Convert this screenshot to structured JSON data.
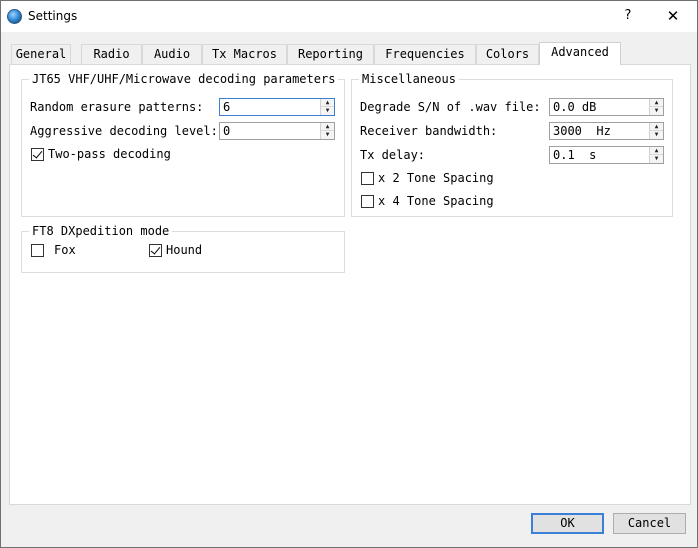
{
  "window": {
    "title": "Settings",
    "help_label": "?",
    "close_label": "✕"
  },
  "tabs": [
    {
      "label": "General",
      "active": false
    },
    {
      "label": "Radio",
      "active": false
    },
    {
      "label": "Audio",
      "active": false
    },
    {
      "label": "Tx Macros",
      "active": false
    },
    {
      "label": "Reporting",
      "active": false
    },
    {
      "label": "Frequencies",
      "active": false
    },
    {
      "label": "Colors",
      "active": false
    },
    {
      "label": "Advanced",
      "active": true
    }
  ],
  "jt65": {
    "title": "JT65 VHF/UHF/Microwave decoding parameters",
    "random_erasure": {
      "label": "Random erasure patterns:",
      "value": "6"
    },
    "aggressive": {
      "label": "Aggressive decoding level:",
      "value": "0"
    },
    "two_pass": {
      "label": "Two-pass decoding",
      "checked": true
    }
  },
  "misc": {
    "title": "Miscellaneous",
    "degrade": {
      "label": "Degrade S/N of .wav file:",
      "value": "0.0 dB"
    },
    "bandwidth": {
      "label": "Receiver bandwidth:",
      "value": "3000  Hz"
    },
    "tx_delay": {
      "label": "Tx delay:",
      "value": "0.1  s"
    },
    "x2": {
      "label": "x 2 Tone Spacing",
      "checked": false
    },
    "x4": {
      "label": "x 4 Tone Spacing",
      "checked": false
    }
  },
  "ft8": {
    "title": "FT8 DXpedition mode",
    "fox": {
      "label": "Fox",
      "checked": false
    },
    "hound": {
      "label": "Hound",
      "checked": true
    }
  },
  "buttons": {
    "ok": "OK",
    "cancel": "Cancel"
  },
  "colors": {
    "focus_border": "#3a7fd1",
    "default_button_border": "#3c7fd6"
  },
  "icons": {
    "app": "globe-icon",
    "spin_up": "triangle-up-icon",
    "spin_down": "triangle-down-icon"
  }
}
